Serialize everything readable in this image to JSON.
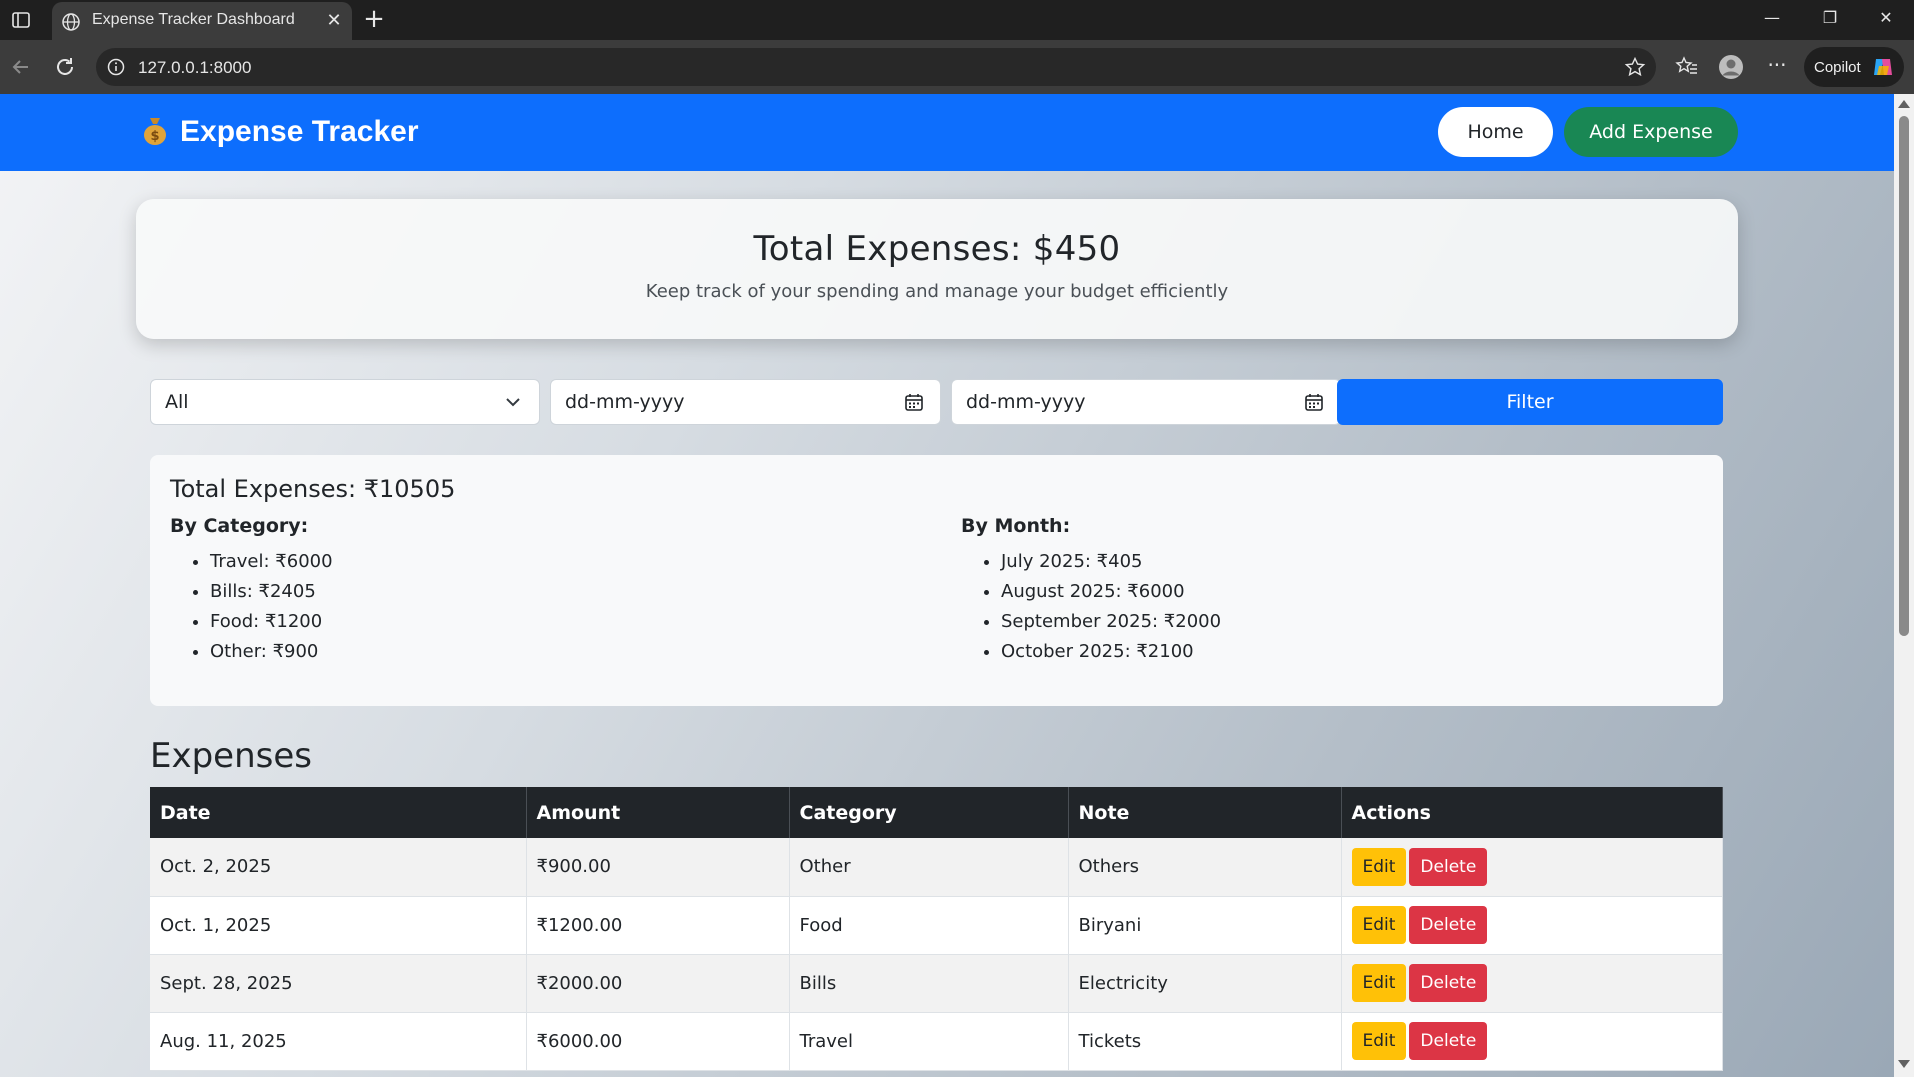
{
  "browser": {
    "tab_title": "Expense Tracker Dashboard",
    "url": "127.0.0.1:8000",
    "copilot_label": "Copilot"
  },
  "navbar": {
    "brand": "Expense Tracker",
    "home_label": "Home",
    "add_label": "Add Expense"
  },
  "hero": {
    "title": "Total Expenses: $450",
    "subtitle": "Keep track of your spending and manage your budget efficiently"
  },
  "filters": {
    "category_value": "All",
    "start_date_placeholder": "dd-mm-yyyy",
    "end_date_placeholder": "dd-mm-yyyy",
    "filter_label": "Filter"
  },
  "summary": {
    "total": "Total Expenses: ₹10505",
    "by_category_heading": "By Category:",
    "by_category": [
      "Travel: ₹6000",
      "Bills: ₹2405",
      "Food: ₹1200",
      "Other: ₹900"
    ],
    "by_month_heading": "By Month:",
    "by_month": [
      "July 2025: ₹405",
      "August 2025: ₹6000",
      "September 2025: ₹2000",
      "October 2025: ₹2100"
    ]
  },
  "expenses": {
    "title": "Expenses",
    "columns": [
      "Date",
      "Amount",
      "Category",
      "Note",
      "Actions"
    ],
    "edit_label": "Edit",
    "delete_label": "Delete",
    "rows": [
      {
        "date": "Oct. 2, 2025",
        "amount": "₹900.00",
        "category": "Other",
        "note": "Others"
      },
      {
        "date": "Oct. 1, 2025",
        "amount": "₹1200.00",
        "category": "Food",
        "note": "Biryani"
      },
      {
        "date": "Sept. 28, 2025",
        "amount": "₹2000.00",
        "category": "Bills",
        "note": "Electricity"
      },
      {
        "date": "Aug. 11, 2025",
        "amount": "₹6000.00",
        "category": "Travel",
        "note": "Tickets"
      }
    ]
  },
  "colors": {
    "primary": "#0d6efd",
    "success": "#198754",
    "warning": "#ffc107",
    "danger": "#dc3545",
    "dark": "#212529"
  }
}
